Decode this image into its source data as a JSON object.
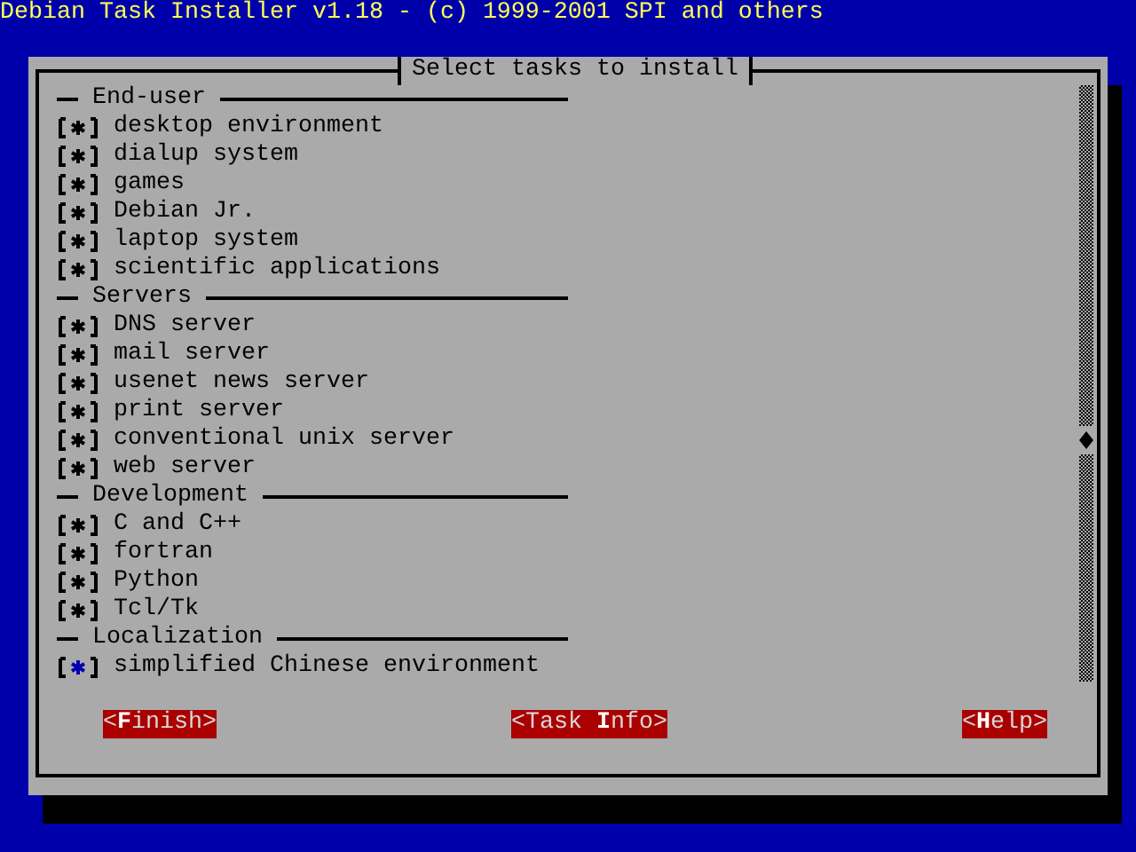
{
  "screen_title": "Debian Task Installer v1.18 - (c) 1999-2001 SPI and others",
  "dialog": {
    "title": "Select tasks to install",
    "sections": [
      {
        "title": "End-user",
        "items": [
          {
            "label": "desktop environment",
            "checked": true,
            "selected": false
          },
          {
            "label": "dialup system",
            "checked": true,
            "selected": false
          },
          {
            "label": "games",
            "checked": true,
            "selected": false
          },
          {
            "label": "Debian Jr.",
            "checked": true,
            "selected": false
          },
          {
            "label": "laptop system",
            "checked": true,
            "selected": false
          },
          {
            "label": "scientific applications",
            "checked": true,
            "selected": false
          }
        ]
      },
      {
        "title": "Servers",
        "items": [
          {
            "label": "DNS server",
            "checked": true,
            "selected": false
          },
          {
            "label": "mail server",
            "checked": true,
            "selected": false
          },
          {
            "label": "usenet news server",
            "checked": true,
            "selected": false
          },
          {
            "label": "print server",
            "checked": true,
            "selected": false
          },
          {
            "label": "conventional unix server",
            "checked": true,
            "selected": false
          },
          {
            "label": "web server",
            "checked": true,
            "selected": false
          }
        ]
      },
      {
        "title": "Development",
        "items": [
          {
            "label": "C and C++",
            "checked": true,
            "selected": false
          },
          {
            "label": "fortran",
            "checked": true,
            "selected": false
          },
          {
            "label": "Python",
            "checked": true,
            "selected": false
          },
          {
            "label": "Tcl/Tk",
            "checked": true,
            "selected": false
          }
        ]
      },
      {
        "title": "Localization",
        "items": [
          {
            "label": "simplified Chinese environment",
            "checked": true,
            "selected": true
          }
        ]
      }
    ],
    "buttons": [
      {
        "label": "<**F**inish>"
      },
      {
        "label": "<Task **I**nfo>"
      },
      {
        "label": "<**H**elp>"
      }
    ]
  }
}
